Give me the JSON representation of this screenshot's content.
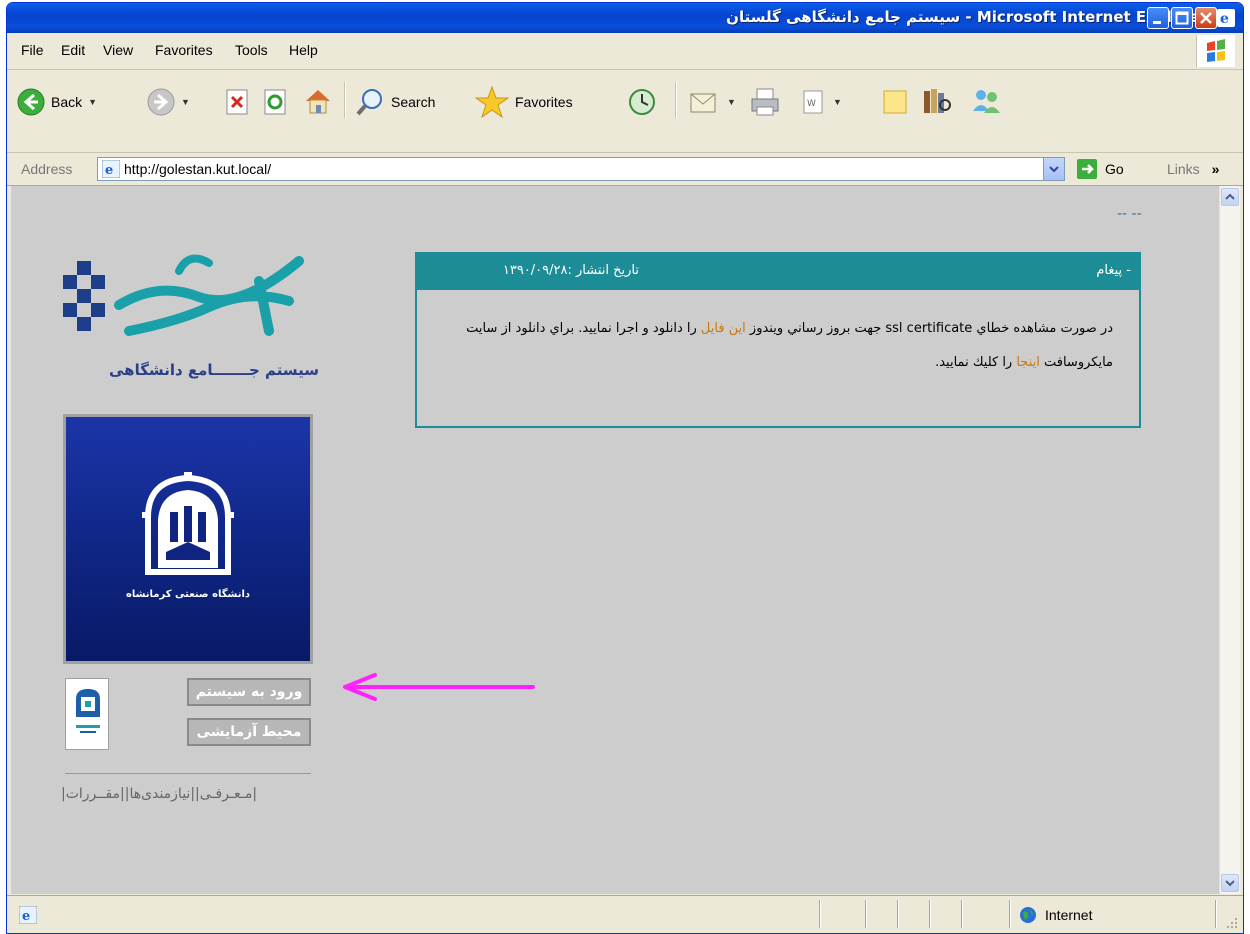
{
  "window": {
    "title": "سیستم جامع دانشگاهی گلستان - Microsoft Internet Explorer"
  },
  "menu": [
    "File",
    "Edit",
    "View",
    "Favorites",
    "Tools",
    "Help"
  ],
  "toolbar": {
    "back_label": "Back",
    "search_label": "Search",
    "favorites_label": "Favorites"
  },
  "address": {
    "label": "Address",
    "url": "http://golestan.kut.local/",
    "go_label": "Go",
    "links_label": "Links"
  },
  "status": {
    "zone_label": "Internet"
  },
  "page": {
    "top_marker": "-- --",
    "logo_text": "گلستان",
    "logo_subtitle": "سیستم جـــــــامع دانشگاهی",
    "university_name": "دانشگاه صنعتی کرمانشاه",
    "login_button": "ورود به سیستم",
    "test_env_button": "محیط آزمایشی",
    "footer_links": "|مـعـرفـی||نیازمندی‌ها||مقــررات|",
    "message": {
      "title": "- پيغام",
      "date_label": "تاريخ انتشار :١٣٩٠/٠٩/٢٨",
      "body_part1": "در صورت مشاهده خطاي ssl certificate جهت بروز رساني ويندوز ",
      "link1": "اين فايل",
      "body_part2": " را دانلود و اجرا نماييد. براي دانلود از سايت مايكروسافت ",
      "link2": "اينجا",
      "body_part3": " را كليك نماييد."
    }
  },
  "colors": {
    "titlebar": "#0a4dd8",
    "message_header": "#1c8d97",
    "content_bg": "#cdcdcd",
    "link": "#c57a12",
    "arrow": "#ff22ff"
  }
}
